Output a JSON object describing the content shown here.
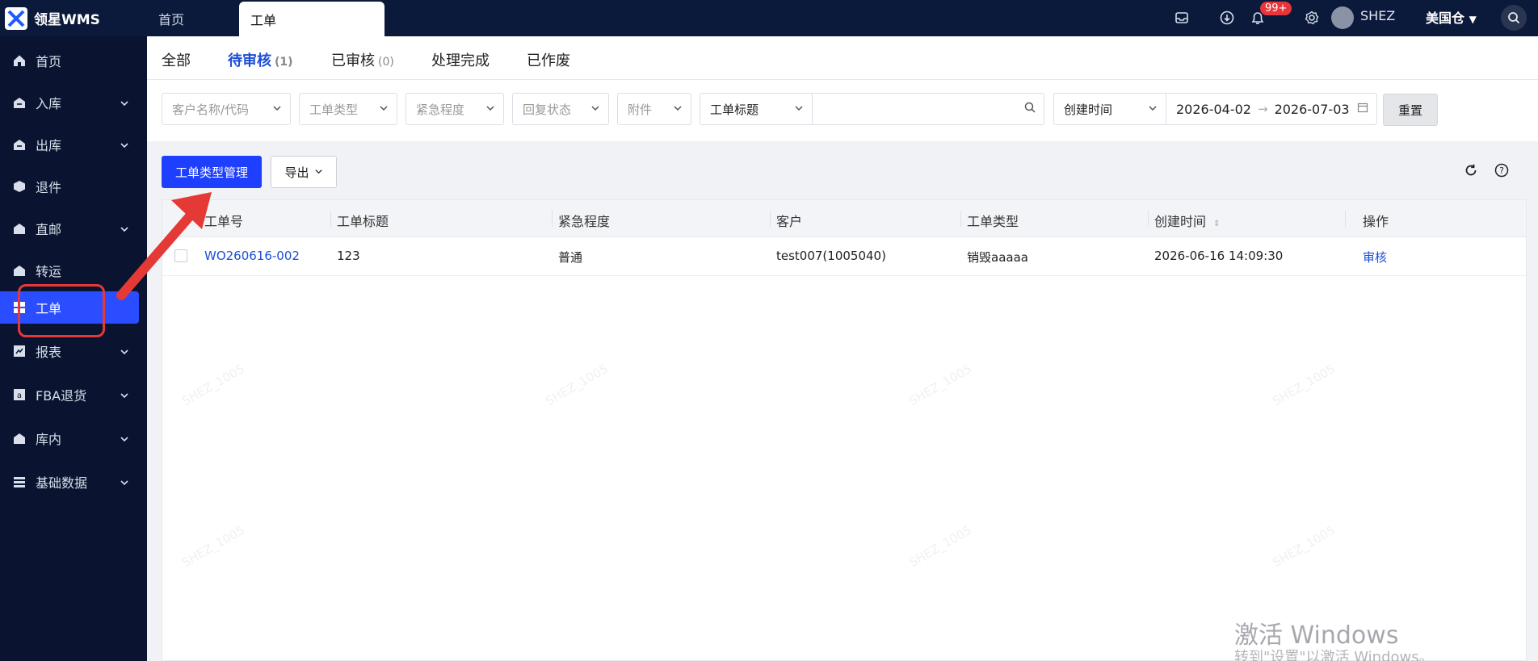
{
  "topbar": {
    "app_name": "领星WMS",
    "tabs": [
      {
        "label": "首页",
        "active": false
      },
      {
        "label": "工单",
        "active": true
      }
    ],
    "notification_badge": "99+",
    "username": "SHEZ",
    "warehouse": "美国仓",
    "icons": [
      "inbox-icon",
      "download-icon",
      "bell-icon",
      "settings-icon",
      "avatar",
      "search-icon"
    ]
  },
  "sidebar": {
    "items": [
      {
        "label": "首页",
        "icon": "home-icon",
        "has_children": false
      },
      {
        "label": "入库",
        "icon": "inbound-icon",
        "has_children": true
      },
      {
        "label": "出库",
        "icon": "outbound-icon",
        "has_children": true
      },
      {
        "label": "退件",
        "icon": "return-icon",
        "has_children": false
      },
      {
        "label": "直邮",
        "icon": "direct-mail-icon",
        "has_children": true
      },
      {
        "label": "转运",
        "icon": "transfer-icon",
        "has_children": false
      },
      {
        "label": "工单",
        "icon": "workorder-icon",
        "has_children": false,
        "active": true
      },
      {
        "label": "报表",
        "icon": "report-icon",
        "has_children": true
      },
      {
        "label": "FBA退货",
        "icon": "fba-icon",
        "has_children": true
      },
      {
        "label": "库内",
        "icon": "warehouse-icon",
        "has_children": true
      },
      {
        "label": "基础数据",
        "icon": "data-icon",
        "has_children": true
      }
    ]
  },
  "subtabs": [
    {
      "label": "全部",
      "count": ""
    },
    {
      "label": "待审核",
      "count": "(1)",
      "active": true
    },
    {
      "label": "已审核",
      "count": "(0)"
    },
    {
      "label": "处理完成",
      "count": ""
    },
    {
      "label": "已作废",
      "count": ""
    }
  ],
  "filters": {
    "customer_placeholder": "客户名称/代码",
    "type_placeholder": "工单类型",
    "urgency_placeholder": "紧急程度",
    "reply_placeholder": "回复状态",
    "attachment_placeholder": "附件",
    "search_field_select": "工单标题",
    "search_value": "",
    "date_field_select": "创建时间",
    "date_start": "2026-04-02",
    "date_end": "2026-07-03",
    "reset_label": "重置"
  },
  "toolbar": {
    "type_mgmt_label": "工单类型管理",
    "export_label": "导出"
  },
  "table": {
    "columns": [
      "工单号",
      "工单标题",
      "紧急程度",
      "客户",
      "工单类型",
      "创建时间",
      "操作"
    ],
    "rows": [
      {
        "order_no": "WO260616-002",
        "title": "123",
        "urgency": "普通",
        "customer": "test007(1005040)",
        "type": "销毁aaaaa",
        "created": "2026-06-16 14:09:30",
        "action": "审核"
      }
    ]
  },
  "watermark": "SHEZ_1005",
  "os_overlay": {
    "title": "激活 Windows",
    "subtitle": "转到\"设置\"以激活 Windows。"
  },
  "colors": {
    "topbar_bg": "#0b1a3a",
    "sidebar_bg": "#0a1430",
    "accent": "#1f3fff",
    "link": "#1d4ed8",
    "annotation_red": "#e53935"
  }
}
